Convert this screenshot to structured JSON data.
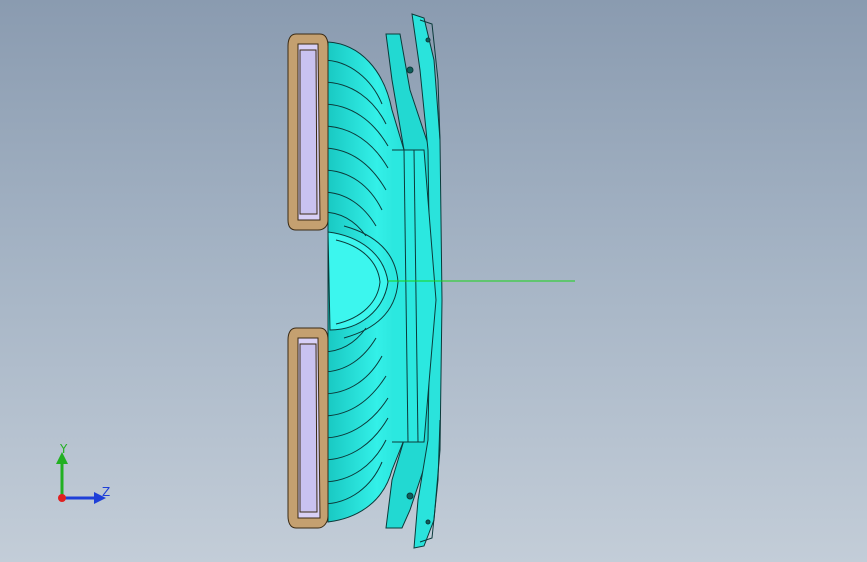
{
  "triad": {
    "y_label": "Y",
    "z_label": "Z",
    "y_color": "#22b022",
    "z_color": "#1e3fd8",
    "origin_color": "#e02020"
  },
  "colors": {
    "body": "#27e6df",
    "body_dark": "#16b8b3",
    "edge": "#0b3a3a",
    "frame": "#c4a070",
    "frame_edge": "#3a2a14",
    "lens": "#c9c2f0",
    "axis_line": "#19d419"
  }
}
